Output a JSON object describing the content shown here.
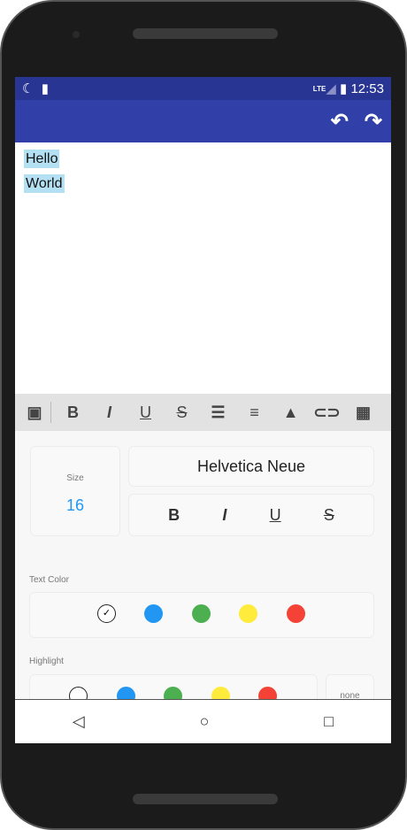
{
  "status": {
    "time": "12:53",
    "network": "LTE"
  },
  "editor": {
    "lines": [
      "Hello",
      "World"
    ]
  },
  "toolbar": {
    "items": [
      "bold",
      "italic",
      "underline",
      "strikethrough",
      "bulleted-list",
      "numbered-list",
      "image",
      "link",
      "table"
    ]
  },
  "font": {
    "size_label": "Size",
    "size_value": "16",
    "family": "Helvetica Neue"
  },
  "text_color": {
    "label": "Text Color",
    "colors": [
      "#ffffff",
      "#2196f3",
      "#4caf50",
      "#ffeb3b",
      "#f44336"
    ],
    "selected": 0
  },
  "highlight": {
    "label": "Highlight",
    "colors": [
      "#ffffff",
      "#2196f3",
      "#4caf50",
      "#ffeb3b",
      "#f44336"
    ],
    "none_label": "none"
  }
}
